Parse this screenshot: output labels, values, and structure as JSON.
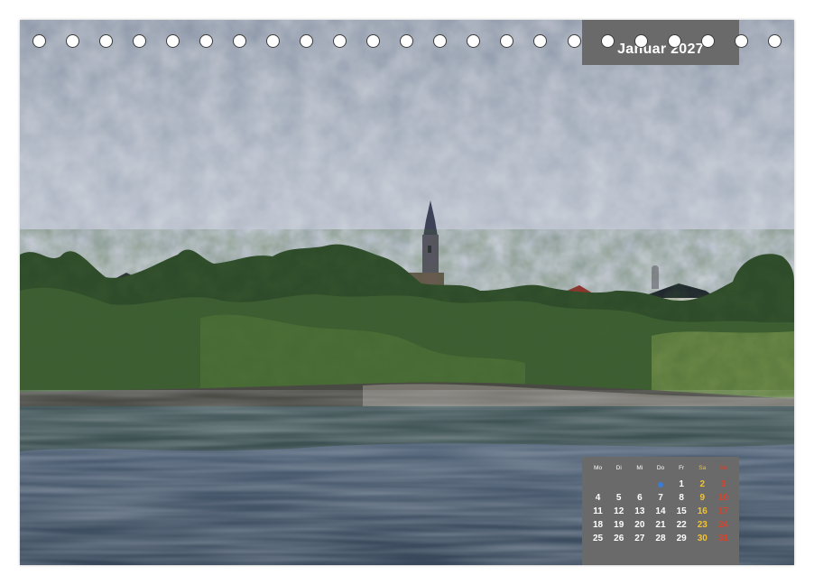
{
  "calendar": {
    "month_title": "Januar 2027",
    "weekday_headers": [
      "Mo",
      "Di",
      "Mi",
      "Do",
      "Fr",
      "Sa",
      "So"
    ],
    "leading_blank_days": 4,
    "weeks": [
      [
        "",
        "",
        "",
        "",
        "1",
        "2",
        "3"
      ],
      [
        "4",
        "5",
        "6",
        "7",
        "8",
        "9",
        "10"
      ],
      [
        "11",
        "12",
        "13",
        "14",
        "15",
        "16",
        "17"
      ],
      [
        "18",
        "19",
        "20",
        "21",
        "22",
        "23",
        "24"
      ],
      [
        "25",
        "26",
        "27",
        "28",
        "29",
        "30",
        "31"
      ]
    ],
    "colors": {
      "panel": "#6a6a6a",
      "weekday": "#ffffff",
      "saturday": "#f1c232",
      "sunday": "#d9432b",
      "holiday_marker": "#3a7bd5"
    }
  },
  "binding_rings": {
    "count": 23
  },
  "icons": {
    "ring": "binding-ring-icon",
    "holiday": "holiday-dot-icon"
  }
}
